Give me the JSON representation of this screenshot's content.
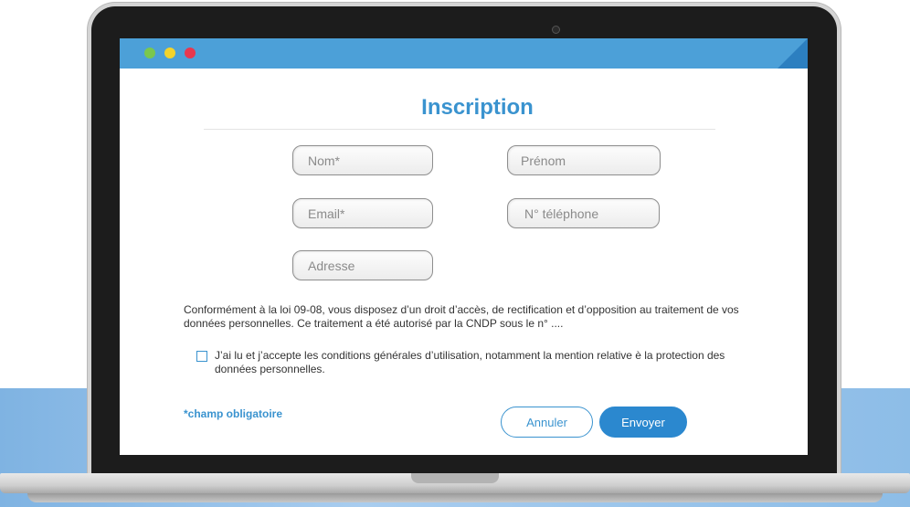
{
  "window": {
    "dots": [
      "green",
      "yellow",
      "red"
    ],
    "accent_color": "#4ca0d8"
  },
  "form": {
    "title": "Inscription",
    "fields": {
      "nom": {
        "placeholder": "Nom*"
      },
      "prenom": {
        "placeholder": "Prénom"
      },
      "email": {
        "placeholder": "Email*"
      },
      "telephone": {
        "placeholder": "N° téléphone"
      },
      "adresse": {
        "placeholder": "Adresse"
      }
    },
    "notice": "Conformément à la loi 09-08, vous disposez d’un droit d’accès, de rectification et d’opposition au traitement de vos données personnelles. Ce traitement a été autorisé par la CNDP sous le n° ....",
    "consent": {
      "label": "J’ai lu et j’accepte les conditions générales d’utilisation, notamment la mention relative è la protection des données personnelles.",
      "checked": false
    },
    "required_note": "*champ obligatoire",
    "buttons": {
      "cancel": "Annuler",
      "submit": "Envoyer"
    }
  }
}
